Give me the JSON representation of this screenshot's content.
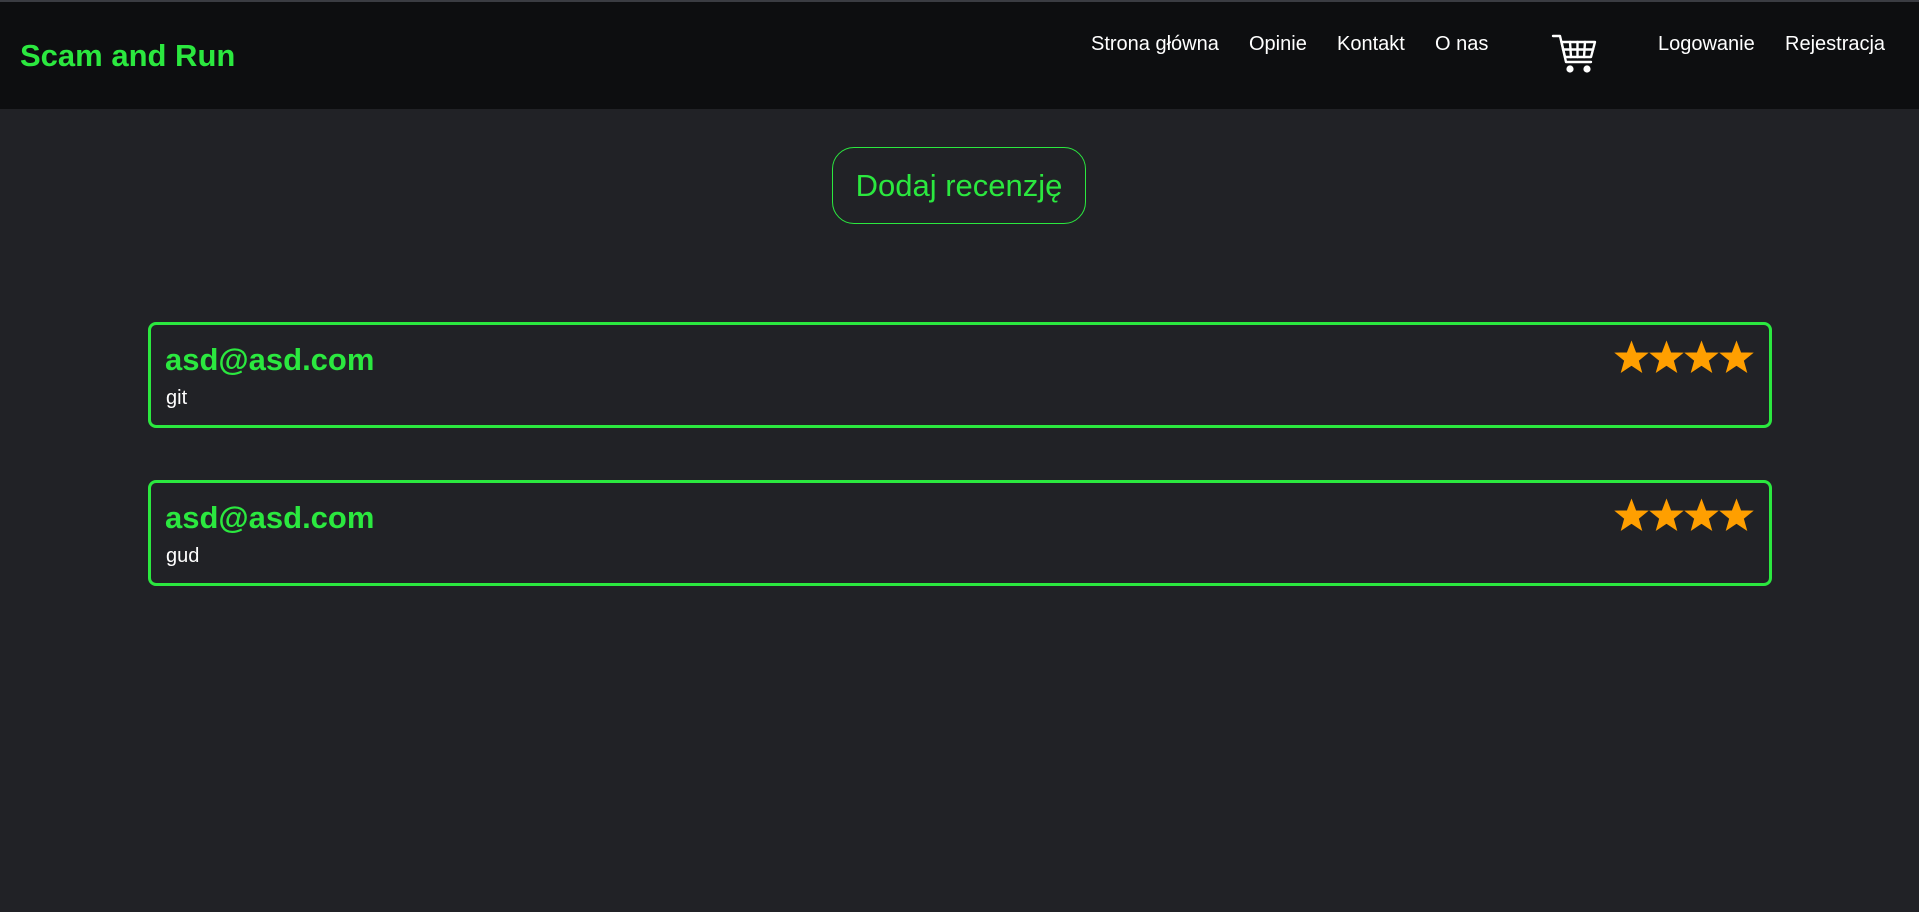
{
  "brand": "Scam and Run",
  "nav": {
    "home": "Strona główna",
    "reviews": "Opinie",
    "contact": "Kontakt",
    "about": "O nas",
    "login": "Logowanie",
    "register": "Rejestracja",
    "cart_icon": "shopping-cart-icon"
  },
  "actions": {
    "add_review": "Dodaj recenzję"
  },
  "reviews": [
    {
      "author": "asd@asd.com",
      "text": "git",
      "rating": 4,
      "max_rating": 4
    },
    {
      "author": "asd@asd.com",
      "text": "gud",
      "rating": 4,
      "max_rating": 4
    }
  ],
  "colors": {
    "accent": "#2be83f",
    "background": "#212226",
    "navbar": "#0d0e10",
    "star": "#ff9f00",
    "text": "#ffffff"
  }
}
